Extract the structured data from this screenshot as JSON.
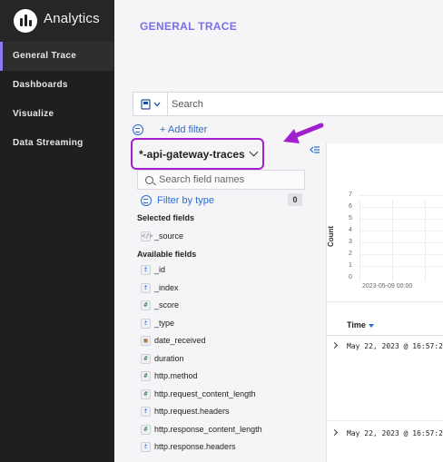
{
  "app": {
    "name": "Analytics"
  },
  "sidebar": {
    "items": [
      {
        "label": "General Trace",
        "active": true
      },
      {
        "label": "Dashboards"
      },
      {
        "label": "Visualize"
      },
      {
        "label": "Data Streaming"
      }
    ]
  },
  "page": {
    "title": "GENERAL TRACE"
  },
  "search": {
    "placeholder": "Search"
  },
  "filter": {
    "add_label": "+ Add filter"
  },
  "index_pattern": {
    "name": "*-api-gateway-traces"
  },
  "fields_panel": {
    "search_placeholder": "Search field names",
    "filter_by_type_label": "Filter by type",
    "filter_count": "0",
    "selected_title": "Selected fields",
    "selected": [
      {
        "name": "_source",
        "type": "source"
      }
    ],
    "available_title": "Available fields",
    "available": [
      {
        "name": "_id",
        "type": "t"
      },
      {
        "name": "_index",
        "type": "t"
      },
      {
        "name": "_score",
        "type": "#"
      },
      {
        "name": "_type",
        "type": "t"
      },
      {
        "name": "date_received",
        "type": "date"
      },
      {
        "name": "duration",
        "type": "#"
      },
      {
        "name": "http.method",
        "type": "#"
      },
      {
        "name": "http.request_content_length",
        "type": "#"
      },
      {
        "name": "http.request.headers",
        "type": "t"
      },
      {
        "name": "http.response_content_length",
        "type": "#"
      },
      {
        "name": "http.response.headers",
        "type": "t"
      }
    ]
  },
  "chart_data": {
    "type": "bar",
    "ylabel": "Count",
    "yticks": [
      "7",
      "6",
      "5",
      "4",
      "3",
      "2",
      "1",
      "0"
    ],
    "xticks": [
      "2023-05-09 00:00"
    ],
    "ylim": [
      0,
      7
    ],
    "values": []
  },
  "table": {
    "time_header": "Time",
    "rows": [
      {
        "time": "May 22, 2023 @ 16:57:2"
      },
      {
        "time": "May 22, 2023 @ 16:57:2"
      }
    ]
  },
  "colors": {
    "accent": "#7b6ee8",
    "link": "#2c6cd0",
    "highlight": "#a020d0",
    "sidebar_bg": "#1f1f1f"
  }
}
